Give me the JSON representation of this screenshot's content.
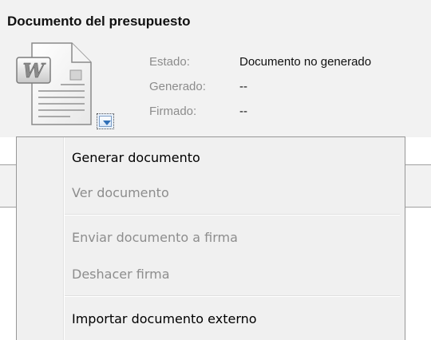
{
  "section": {
    "title": "Documento del presupuesto"
  },
  "document": {
    "icon": "word-document-icon",
    "fields": [
      {
        "label": "Estado:",
        "value": "Documento no generado"
      },
      {
        "label": "Generado:",
        "value": "--"
      },
      {
        "label": "Firmado:",
        "value": "--"
      }
    ],
    "dropdown_icon": "chevron-down-icon"
  },
  "menu": {
    "items": [
      {
        "label": "Generar documento",
        "enabled": true
      },
      {
        "label": "Ver documento",
        "enabled": false
      },
      {
        "label": "Enviar documento a firma",
        "enabled": false
      },
      {
        "label": "Deshacer firma",
        "enabled": false
      },
      {
        "label": "Importar documento externo",
        "enabled": true
      }
    ]
  },
  "colors": {
    "panel_background": "#f2f2f2",
    "menu_background": "#f0f0f0",
    "label_gray": "#8c8c8c",
    "disabled_text": "#8d8d8d",
    "accent_blue": "#2f6fb7"
  }
}
